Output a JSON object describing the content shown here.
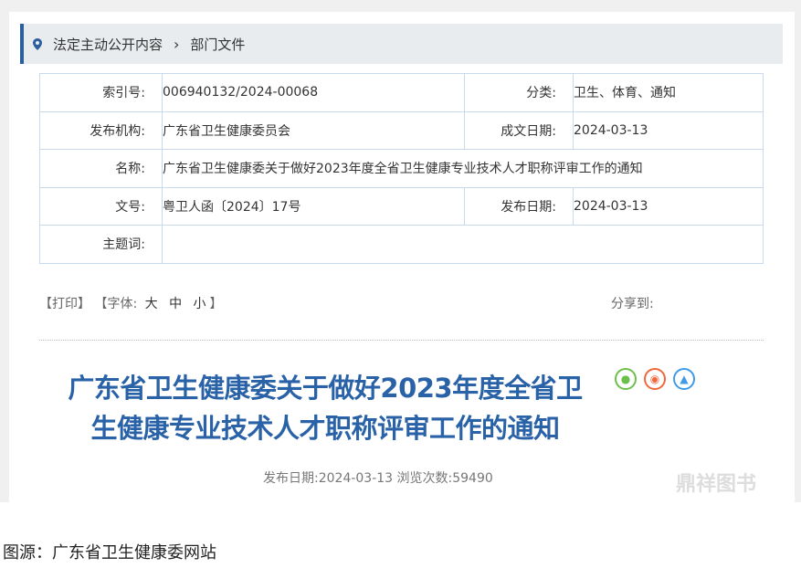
{
  "breadcrumb": {
    "items": [
      "法定主动公开内容",
      "部门文件"
    ]
  },
  "info": {
    "index_label": "索引号:",
    "index": "006940132/2024-00068",
    "category_label": "分类:",
    "category": "卫生、体育、通知",
    "publisher_label": "发布机构:",
    "publisher": "广东省卫生健康委员会",
    "created_label": "成文日期:",
    "created": "2024-03-13",
    "name_label": "名称:",
    "name": "广东省卫生健康委关于做好2023年度全省卫生健康专业技术人才职称评审工作的通知",
    "docno_label": "文号:",
    "docno": "粤卫人函〔2024〕17号",
    "pubdate_label": "发布日期:",
    "pubdate": "2024-03-13",
    "subject_label": "主题词:"
  },
  "tools": {
    "print": "【打印】",
    "font_label": "【字体:",
    "large": "大",
    "medium": "中",
    "small": "小",
    "close": "】",
    "share": "分享到:"
  },
  "article": {
    "title_line1": "广东省卫生健康委关于做好2023年度全省卫",
    "title_line2": "生健康专业技术人才职称评审工作的通知",
    "meta": "发布日期:2024-03-13  浏览次数:59490"
  },
  "watermark": "鼎祥图书",
  "caption": "图源：广东省卫生健康委网站",
  "colors": {
    "accent": "#2a62a8",
    "wechat": "#6cc04a",
    "weibo": "#f0683a",
    "qq": "#3d9be9"
  }
}
